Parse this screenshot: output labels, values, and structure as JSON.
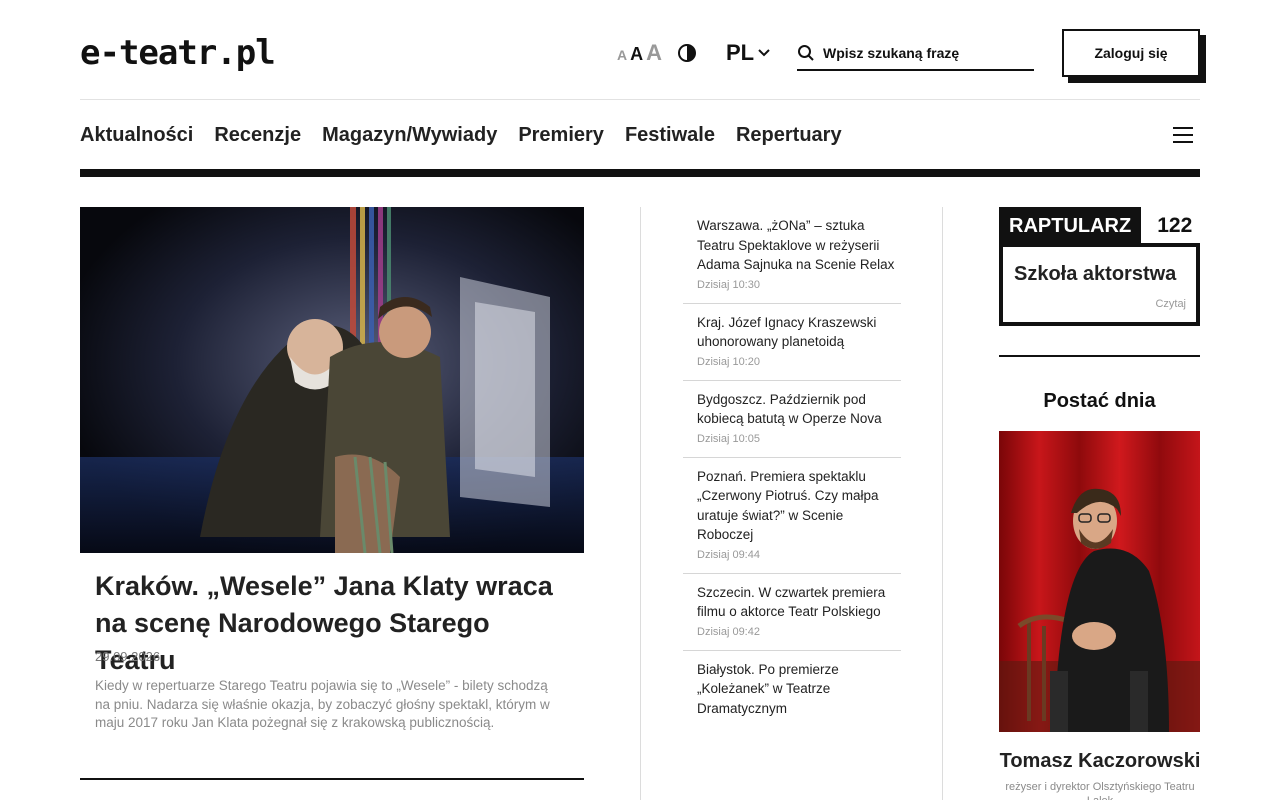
{
  "header": {
    "logo": "e-teatr.pl",
    "font_sizes": [
      "A",
      "A",
      "A"
    ],
    "language": "PL",
    "search_placeholder": "Wpisz szukaną frazę",
    "login_label": "Zaloguj się"
  },
  "nav": {
    "items": [
      "Aktualności",
      "Recenzje",
      "Magazyn/Wywiady",
      "Premiery",
      "Festiwale",
      "Repertuary"
    ]
  },
  "main_story": {
    "title": "Kraków. „Wesele” Jana Klaty wraca na scenę Narodowego Starego Teatru",
    "date": "29.09.2026",
    "lead": "Kiedy w repertuarze Starego Teatru pojawia się to „Wesele” - bilety schodzą na pniu. Nadarza się właśnie okazja, by zobaczyć głośny spektakl, którym w maju 2017 roku Jan Klata pożegnał się z krakowską publicznością."
  },
  "news": [
    {
      "title": "Warszawa. „żONa” – sztuka Teatru Spektaklove w reżyserii Adama Sajnuka na Scenie Relax",
      "time": "Dzisiaj 10:30"
    },
    {
      "title": "Kraj. Józef Ignacy Kraszewski uhonorowany planetoidą",
      "time": "Dzisiaj 10:20"
    },
    {
      "title": "Bydgoszcz. Październik pod kobiecą batutą w Operze Nova",
      "time": "Dzisiaj 10:05"
    },
    {
      "title": "Poznań. Premiera spektaklu „Czerwony Piotruś. Czy małpa uratuje świat?” w Scenie Roboczej",
      "time": "Dzisiaj 09:44"
    },
    {
      "title": "Szczecin. W czwartek premiera filmu o aktorce Teatr Polskiego",
      "time": "Dzisiaj 09:42"
    },
    {
      "title": "Białystok. Po premierze „Koleżanek” w Teatrze Dramatycznym",
      "time": ""
    }
  ],
  "raptularz": {
    "label": "RAPTULARZ",
    "number": "122",
    "title": "Szkoła aktorstwa",
    "read": "Czytaj"
  },
  "postac": {
    "heading": "Postać dnia",
    "name": "Tomasz Kaczorowski",
    "description": "reżyser i dyrektor Olsztyńskiego Teatru Lalek"
  },
  "colors": {
    "text": "#111111",
    "muted": "#8a8a8a",
    "accent_red": "#b00d10"
  }
}
